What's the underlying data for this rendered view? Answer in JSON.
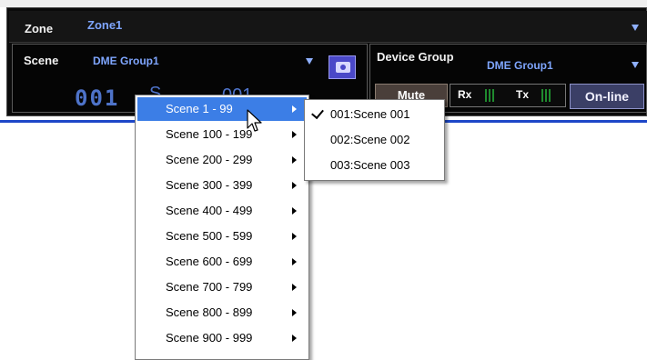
{
  "zone": {
    "label": "Zone",
    "value": "Zone1"
  },
  "scene": {
    "label": "Scene",
    "group": "DME Group1",
    "number_display": "001",
    "name_display_partial": "S",
    "name_display_right": "001"
  },
  "device_group": {
    "label": "Device Group",
    "value": "DME Group1"
  },
  "controls": {
    "mute_label": "Mute",
    "rx_label": "Rx",
    "tx_label": "Tx",
    "online_label": "On-line"
  },
  "menu": {
    "items": [
      {
        "label": "Scene 1 - 99"
      },
      {
        "label": "Scene 100 - 199"
      },
      {
        "label": "Scene 200 - 299"
      },
      {
        "label": "Scene 300 - 399"
      },
      {
        "label": "Scene 400 - 499"
      },
      {
        "label": "Scene 500 - 599"
      },
      {
        "label": "Scene 600 - 699"
      },
      {
        "label": "Scene 700 - 799"
      },
      {
        "label": "Scene 800 - 899"
      },
      {
        "label": "Scene 900 - 999"
      }
    ],
    "highlighted_index": 0
  },
  "submenu": {
    "items": [
      {
        "label": "001:Scene 001",
        "checked": true
      },
      {
        "label": "002:Scene 002",
        "checked": false
      },
      {
        "label": "003:Scene 003",
        "checked": false
      }
    ]
  },
  "colors": {
    "panel_bg": "#0b0b0b",
    "accent_blue": "#7fa6ff",
    "highlight": "#3c7ee6",
    "store_button": "#4a48c8"
  },
  "icons": {
    "zone_dropdown": "triangle-down",
    "scene_dropdown": "triangle-down",
    "device_group_dropdown": "triangle-down",
    "store": "camera",
    "submenu_arrow": "triangle-right",
    "check": "checkmark",
    "cursor": "mouse-pointer"
  }
}
